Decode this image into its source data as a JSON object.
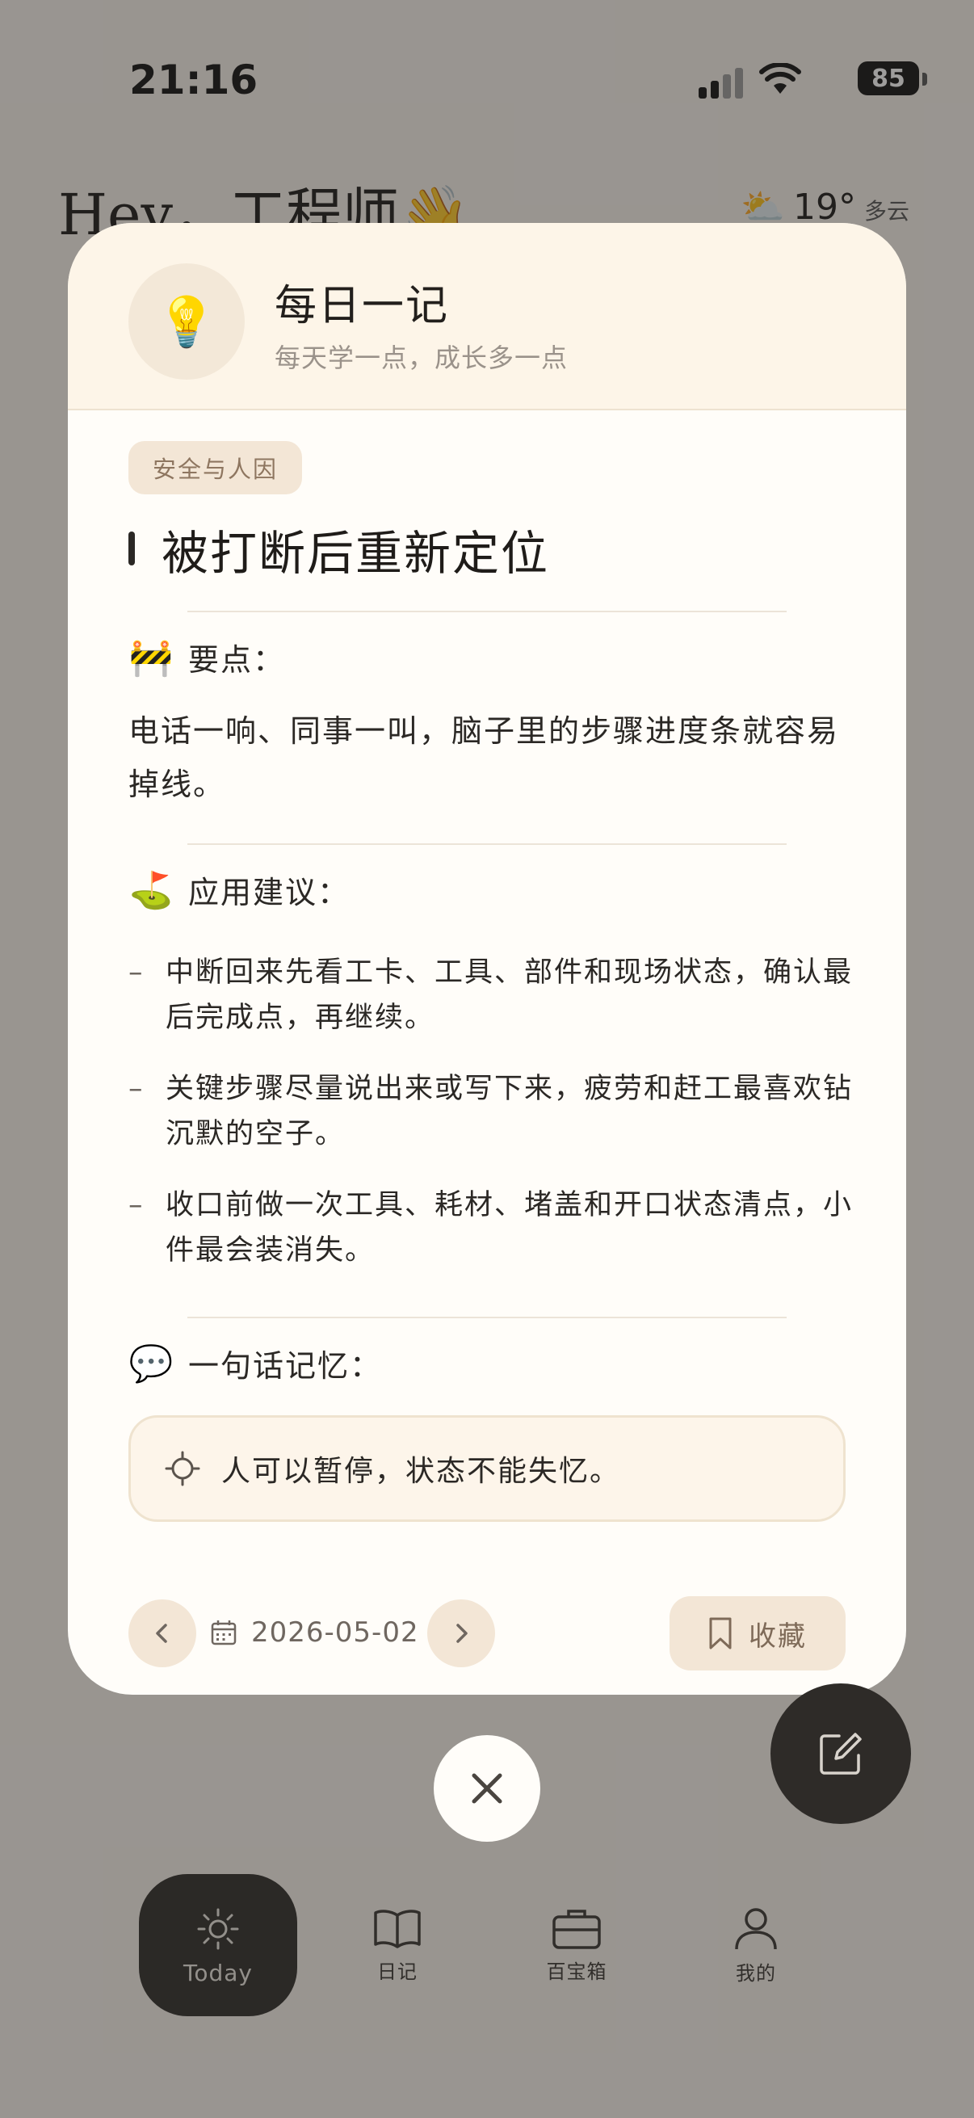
{
  "status": {
    "time": "21:16",
    "battery": "85"
  },
  "background": {
    "greeting": "Hey，工程师👋",
    "weather_temp": "19°",
    "weather_condition": "多云",
    "weather_icon": "partly-cloudy-icon"
  },
  "modal": {
    "icon": "lightbulb-icon",
    "title": "每日一记",
    "subtitle": "每天学一点，成长多一点",
    "tag": "安全与人因",
    "article_title": "被打断后重新定位",
    "keypoint_heading": "要点：",
    "keypoint_emoji": "🚧",
    "keypoint_text": "电话一响、同事一叫，脑子里的步骤进度条就容易掉线。",
    "suggest_heading": "应用建议：",
    "suggest_emoji": "⛳",
    "suggestions": [
      "中断回来先看工卡、工具、部件和现场状态，确认最后完成点，再继续。",
      "关键步骤尽量说出来或写下来，疲劳和赶工最喜欢钻沉默的空子。",
      "收口前做一次工具、耗材、堵盖和开口状态清点，小件最会装消失。"
    ],
    "memo_heading": "一句话记忆：",
    "memo_emoji": "💬",
    "memo_text": "人可以暂停，状态不能失忆。",
    "date": "2026-05-02",
    "favorite_label": "收藏"
  },
  "tabs": [
    {
      "label": "Today",
      "icon": "sun-icon",
      "active": true
    },
    {
      "label": "日记",
      "icon": "book-icon",
      "active": false
    },
    {
      "label": "百宝箱",
      "icon": "toolbox-icon",
      "active": false
    },
    {
      "label": "我的",
      "icon": "profile-icon",
      "active": false
    }
  ],
  "colors": {
    "accent_dark": "#2e2b28",
    "modal_bg": "#fffdf9",
    "header_bg": "#fdf5e8",
    "chip_bg": "#f3e6d6"
  }
}
